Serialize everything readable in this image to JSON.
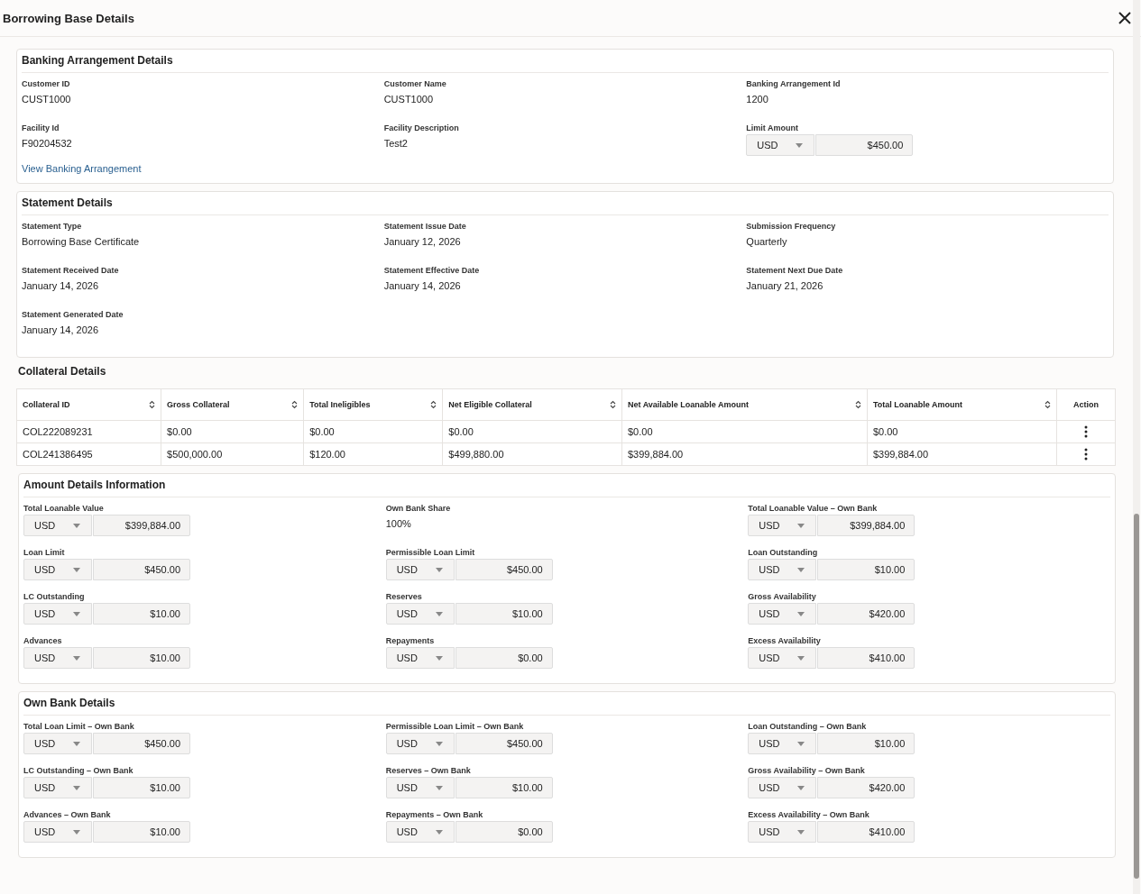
{
  "window": {
    "title": "Borrowing Base Details"
  },
  "banking": {
    "title": "Banking Arrangement Details",
    "fields": [
      {
        "kind": "text",
        "label": "Customer ID",
        "value": "CUST1000"
      },
      {
        "kind": "text",
        "label": "Customer Name",
        "value": "CUST1000"
      },
      {
        "kind": "text",
        "label": "Banking Arrangement Id",
        "value": "1200"
      },
      {
        "kind": "text",
        "label": "Facility Id",
        "value": "F90204532"
      },
      {
        "kind": "text",
        "label": "Facility Description",
        "value": "Test2"
      },
      {
        "kind": "currency",
        "label": "Limit Amount",
        "currency": "USD",
        "value": "$450.00"
      }
    ],
    "link": "View Banking Arrangement"
  },
  "statement": {
    "title": "Statement Details",
    "fields": [
      {
        "kind": "text",
        "label": "Statement Type",
        "value": "Borrowing Base Certificate"
      },
      {
        "kind": "text",
        "label": "Statement Issue Date",
        "value": "January 12, 2026"
      },
      {
        "kind": "text",
        "label": "Submission Frequency",
        "value": "Quarterly"
      },
      {
        "kind": "text",
        "label": "Statement Received Date",
        "value": "January 14, 2026"
      },
      {
        "kind": "text",
        "label": "Statement Effective Date",
        "value": "January 14, 2026"
      },
      {
        "kind": "text",
        "label": "Statement Next Due Date",
        "value": "January 21, 2026"
      },
      {
        "kind": "text",
        "label": "Statement Generated Date",
        "value": "January 14, 2026"
      }
    ]
  },
  "collateral": {
    "title": "Collateral Details",
    "columns": [
      {
        "label": "Collateral ID",
        "sortable": true
      },
      {
        "label": "Gross Collateral",
        "sortable": true
      },
      {
        "label": "Total Ineligibles",
        "sortable": true
      },
      {
        "label": "Net Eligible Collateral",
        "sortable": true
      },
      {
        "label": "Net Available Loanable Amount",
        "sortable": true
      },
      {
        "label": "Total Loanable Amount",
        "sortable": true
      },
      {
        "label": "Action",
        "sortable": false
      }
    ],
    "rows": [
      [
        "COL222089231",
        "$0.00",
        "$0.00",
        "$0.00",
        "$0.00",
        "$0.00"
      ],
      [
        "COL241386495",
        "$500,000.00",
        "$120.00",
        "$499,880.00",
        "$399,884.00",
        "$399,884.00"
      ]
    ]
  },
  "amount": {
    "title": "Amount Details Information",
    "fields": [
      {
        "kind": "currency",
        "label": "Total Loanable Value",
        "currency": "USD",
        "value": "$399,884.00"
      },
      {
        "kind": "text",
        "label": "Own Bank Share",
        "value": "100%"
      },
      {
        "kind": "currency",
        "label": "Total Loanable Value – Own Bank",
        "currency": "USD",
        "value": "$399,884.00"
      },
      {
        "kind": "currency",
        "label": "Loan Limit",
        "currency": "USD",
        "value": "$450.00"
      },
      {
        "kind": "currency",
        "label": "Permissible Loan Limit",
        "currency": "USD",
        "value": "$450.00"
      },
      {
        "kind": "currency",
        "label": "Loan Outstanding",
        "currency": "USD",
        "value": "$10.00"
      },
      {
        "kind": "currency",
        "label": "LC Outstanding",
        "currency": "USD",
        "value": "$10.00"
      },
      {
        "kind": "currency",
        "label": "Reserves",
        "currency": "USD",
        "value": "$10.00"
      },
      {
        "kind": "currency",
        "label": "Gross Availability",
        "currency": "USD",
        "value": "$420.00"
      },
      {
        "kind": "currency",
        "label": "Advances",
        "currency": "USD",
        "value": "$10.00"
      },
      {
        "kind": "currency",
        "label": "Repayments",
        "currency": "USD",
        "value": "$0.00"
      },
      {
        "kind": "currency",
        "label": "Excess Availability",
        "currency": "USD",
        "value": "$410.00"
      }
    ]
  },
  "own_bank": {
    "title": "Own Bank Details",
    "fields": [
      {
        "kind": "currency",
        "label": "Total Loan Limit – Own Bank",
        "currency": "USD",
        "value": "$450.00"
      },
      {
        "kind": "currency",
        "label": "Permissible Loan Limit – Own Bank",
        "currency": "USD",
        "value": "$450.00"
      },
      {
        "kind": "currency",
        "label": "Loan Outstanding – Own Bank",
        "currency": "USD",
        "value": "$10.00"
      },
      {
        "kind": "currency",
        "label": "LC Outstanding – Own Bank",
        "currency": "USD",
        "value": "$10.00"
      },
      {
        "kind": "currency",
        "label": "Reserves – Own Bank",
        "currency": "USD",
        "value": "$10.00"
      },
      {
        "kind": "currency",
        "label": "Gross Availability – Own Bank",
        "currency": "USD",
        "value": "$420.00"
      },
      {
        "kind": "currency",
        "label": "Advances – Own Bank",
        "currency": "USD",
        "value": "$10.00"
      },
      {
        "kind": "currency",
        "label": "Repayments – Own Bank",
        "currency": "USD",
        "value": "$0.00"
      },
      {
        "kind": "currency",
        "label": "Excess Availability – Own Bank",
        "currency": "USD",
        "value": "$410.00"
      }
    ]
  }
}
